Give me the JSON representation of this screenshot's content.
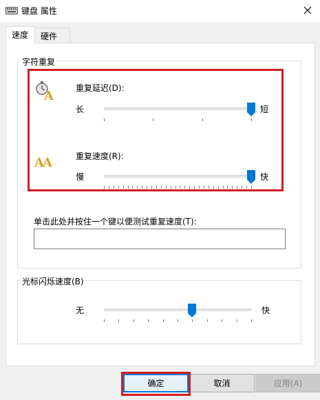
{
  "window": {
    "title": "键盘 属性",
    "icon": "keyboard-icon",
    "close_icon": "close-icon"
  },
  "tabs": [
    {
      "label": "速度",
      "active": true
    },
    {
      "label": "硬件",
      "active": false
    }
  ],
  "char_repeat": {
    "legend": "字符重复",
    "delay": {
      "icon": "stopwatch-a-icon",
      "label": "重复延迟(D):",
      "left_label": "长",
      "right_label": "短",
      "value": 3,
      "min": 0,
      "max": 3
    },
    "rate": {
      "icon": "double-a-icon",
      "label": "重复速度(R):",
      "left_label": "慢",
      "right_label": "快",
      "value": 31,
      "min": 0,
      "max": 31
    },
    "test_label": "单击此处并按住一个键以便测试重复速度(T):",
    "test_value": ""
  },
  "cursor_blink": {
    "legend": "光标闪烁速度(B)",
    "left_label": "无",
    "right_label": "快",
    "value": 6,
    "min": 0,
    "max": 10
  },
  "buttons": {
    "ok": "确定",
    "cancel": "取消",
    "apply": "应用(A)"
  },
  "colors": {
    "accent": "#0078d7",
    "highlight": "#d21c20"
  }
}
